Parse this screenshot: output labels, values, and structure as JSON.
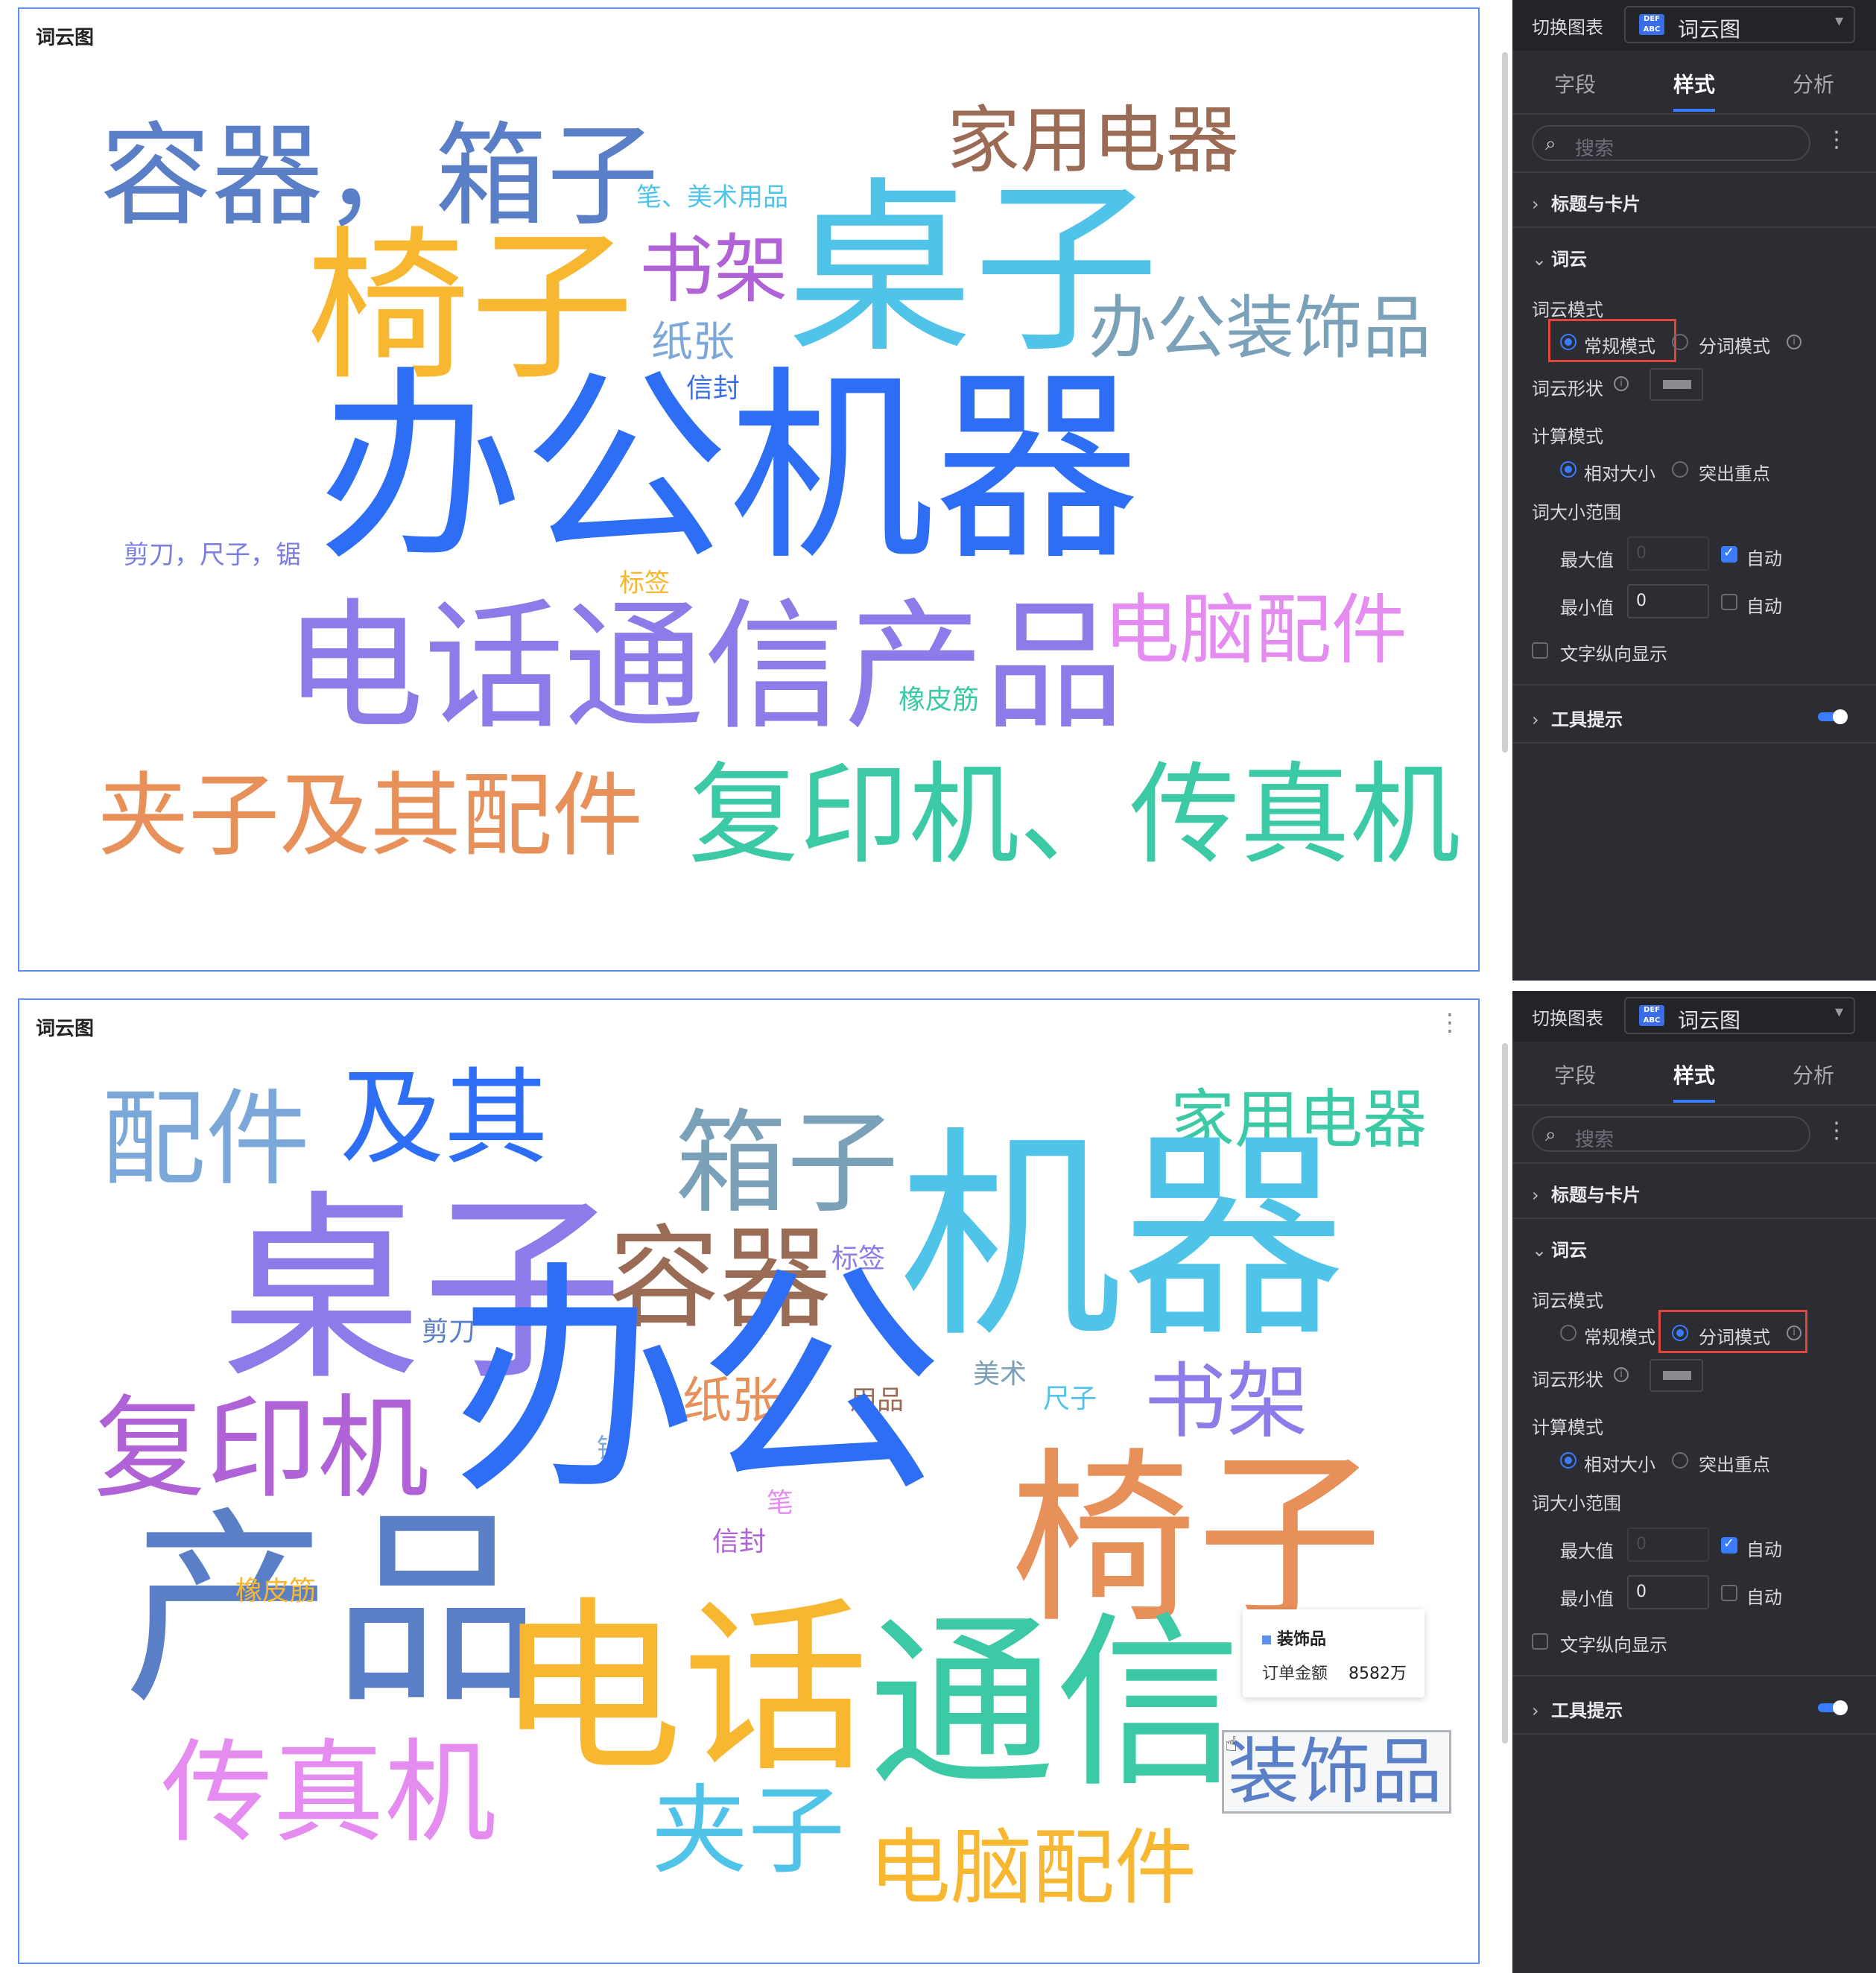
{
  "top": {
    "card_title": "词云图",
    "words": [
      {
        "text": "容器，箱子",
        "color": "#5b7fc7"
      },
      {
        "text": "家用电器",
        "color": "#9a6b55"
      },
      {
        "text": "笔、美术用品",
        "color": "#4fc3e8"
      },
      {
        "text": "椅子",
        "color": "#f7b731"
      },
      {
        "text": "书架",
        "color": "#b063d6"
      },
      {
        "text": "桌子",
        "color": "#4fc3e8"
      },
      {
        "text": "办公装饰品",
        "color": "#7ba1b8"
      },
      {
        "text": "纸张",
        "color": "#7ba7d9"
      },
      {
        "text": "信封",
        "color": "#3a6ee8"
      },
      {
        "text": "办公机器",
        "color": "#2e6ef5"
      },
      {
        "text": "剪刀，尺子，锯",
        "color": "#7b7de0"
      },
      {
        "text": "标签",
        "color": "#f7b731"
      },
      {
        "text": "电话通信产品",
        "color": "#8c7be8"
      },
      {
        "text": "电脑配件",
        "color": "#e58cf0"
      },
      {
        "text": "橡皮筋",
        "color": "#3cc9a6"
      },
      {
        "text": "夹子及其配件",
        "color": "#e8905a"
      },
      {
        "text": "复印机、传真机",
        "color": "#3cc9a6"
      }
    ]
  },
  "bottom": {
    "card_title": "词云图",
    "words": [
      {
        "text": "配件",
        "color": "#7ba7d9"
      },
      {
        "text": "及其",
        "color": "#2e6ef5"
      },
      {
        "text": "箱子",
        "color": "#7ba1b8"
      },
      {
        "text": "家用电器",
        "color": "#3cc9a6"
      },
      {
        "text": "桌子",
        "color": "#8c7be8"
      },
      {
        "text": "容器",
        "color": "#9a6b55"
      },
      {
        "text": "标签",
        "color": "#8c7be8"
      },
      {
        "text": "机器",
        "color": "#4fc3e8"
      },
      {
        "text": "剪刀",
        "color": "#5b7fc7"
      },
      {
        "text": "美术",
        "color": "#7ba1b8"
      },
      {
        "text": "尺子",
        "color": "#4fc3e8"
      },
      {
        "text": "书架",
        "color": "#8c7be8"
      },
      {
        "text": "纸张",
        "color": "#e8905a"
      },
      {
        "text": "用品",
        "color": "#9a6b55"
      },
      {
        "text": "复印机",
        "color": "#b063d6"
      },
      {
        "text": "锯",
        "color": "#7ba7d9"
      },
      {
        "text": "办公",
        "color": "#2e6ef5"
      },
      {
        "text": "椅子",
        "color": "#e8905a"
      },
      {
        "text": "笔",
        "color": "#e58cf0"
      },
      {
        "text": "信封",
        "color": "#b063d6"
      },
      {
        "text": "产品",
        "color": "#5b7fc7"
      },
      {
        "text": "橡皮筋",
        "color": "#f7b731"
      },
      {
        "text": "电话",
        "color": "#f7b731"
      },
      {
        "text": "通信",
        "color": "#3cc9a6"
      },
      {
        "text": "装饰品",
        "color": "#5b7fc7"
      },
      {
        "text": "传真机",
        "color": "#e58cf0"
      },
      {
        "text": "夹子",
        "color": "#4fc3e8"
      },
      {
        "text": "电脑配件",
        "color": "#f7b731"
      }
    ],
    "tooltip": {
      "title": "装饰品",
      "field": "订单金额",
      "value": "8582万"
    }
  },
  "panel": {
    "switch_label": "切换图表",
    "chart_type": "词云图",
    "chart_icon_text": "DEF ABC",
    "tabs": [
      "字段",
      "样式",
      "分析"
    ],
    "search_placeholder": "搜索",
    "section_title_card": "标题与卡片",
    "section_wordcloud": "词云",
    "mode_label": "词云模式",
    "mode_normal": "常规模式",
    "mode_split": "分词模式",
    "shape_label": "词云形状",
    "calc_label": "计算模式",
    "calc_relative": "相对大小",
    "calc_highlight": "突出重点",
    "size_range_label": "词大小范围",
    "max_label": "最大值",
    "min_label": "最小值",
    "auto_label": "自动",
    "max_value": "0",
    "min_value": "0",
    "vertical_label": "文字纵向显示",
    "tooltip_section": "工具提示"
  }
}
